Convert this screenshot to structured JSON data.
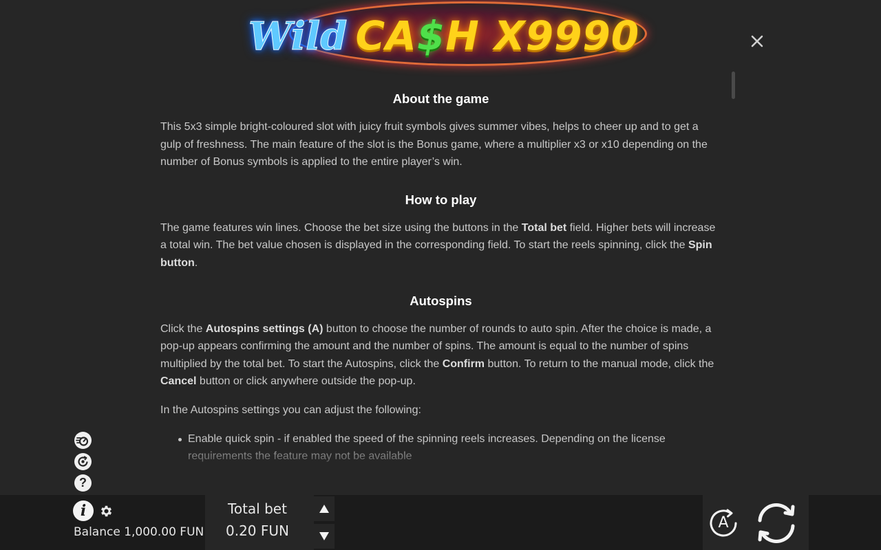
{
  "logo": {
    "word_wild": "Wild",
    "word_cash_a": "CA",
    "word_cash_dollar": "$",
    "word_cash_b": "H",
    "word_multiplier": "X9990"
  },
  "rules": {
    "about": {
      "title": "About the game",
      "text": "This 5x3 simple bright-coloured slot with juicy fruit symbols gives summer vibes, helps to cheer up and to get a gulp of freshness. The main feature of the slot is the Bonus game, where a multiplier x3 or x10 depending on the number of Bonus symbols is applied to the entire player’s win."
    },
    "how_to_play": {
      "title": "How to play",
      "t1": "The game features win lines. Choose the bet size using the buttons in the ",
      "b1": "Total bet",
      "t2": " field. Higher bets will increase a total win. The bet value chosen is displayed in the corresponding field. To start the reels spinning, click the ",
      "b2": "Spin button",
      "t3": "."
    },
    "autospins": {
      "title": "Autospins",
      "t1": "Click the ",
      "b1": "Autospins settings (A)",
      "t2": " button to choose the number of rounds to auto spin. After the choice is made, a pop-up appears confirming the amount and the number of spins. The amount is equal to the number of spins multiplied by the total bet. To start the Autospins, click the ",
      "b2": "Confirm",
      "t3": " button. To return to the manual mode, click the ",
      "b3": "Cancel",
      "t4": " button or click anywhere outside the pop-up.",
      "settings_intro": "In the Autospins settings you can adjust the following:",
      "items": [
        "Enable quick spin - if enabled the speed of the spinning reels increases. Depending on the license requirements the feature may not be available"
      ]
    }
  },
  "side_icons": {
    "turbo": "turbo-icon",
    "history": "history-icon",
    "help": "?"
  },
  "bottom_bar": {
    "balance": "Balance 1,000.00 FUN",
    "total_bet_label": "Total bet",
    "total_bet_value": "0.20 FUN",
    "auto_label": "A",
    "info_label": "i"
  },
  "colors": {
    "background": "#262626",
    "bar": "#1b1b1b",
    "heading": "#ffffff",
    "body_text": "#c8c8c8"
  }
}
